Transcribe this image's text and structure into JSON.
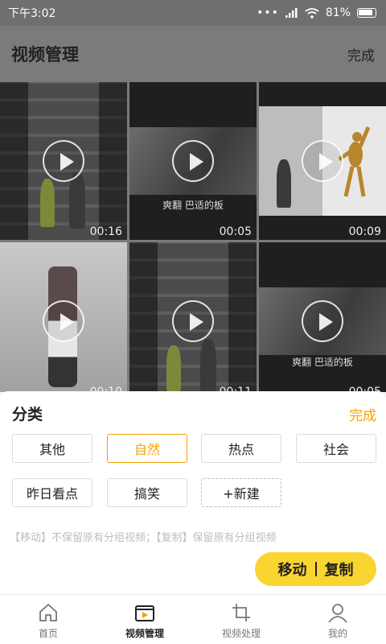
{
  "status_bar": {
    "time": "下午3:02",
    "battery": "81%"
  },
  "header": {
    "title": "视频管理",
    "done_label": "完成"
  },
  "videos": [
    {
      "duration": "00:16",
      "caption": ""
    },
    {
      "duration": "00:05",
      "caption": "爽翻 巴适的板"
    },
    {
      "duration": "00:09",
      "caption": ""
    },
    {
      "duration": "00:10",
      "caption": ""
    },
    {
      "duration": "00:11",
      "caption": ""
    },
    {
      "duration": "00:05",
      "caption": "爽翻 巴适的板"
    }
  ],
  "sheet": {
    "title": "分类",
    "done_label": "完成",
    "categories": [
      {
        "label": "其他",
        "selected": false
      },
      {
        "label": "自然",
        "selected": true
      },
      {
        "label": "热点",
        "selected": false
      },
      {
        "label": "社会",
        "selected": false
      },
      {
        "label": "昨日看点",
        "selected": false
      },
      {
        "label": "搞笑",
        "selected": false
      }
    ],
    "new_label": "+新建",
    "hint": "【移动】不保留原有分组视频；【复制】保留原有分组视频",
    "move_label": "移动",
    "copy_label": "复制"
  },
  "tabs": [
    {
      "label": "首页",
      "icon": "home-icon",
      "active": false
    },
    {
      "label": "视频管理",
      "icon": "video-manage-icon",
      "active": true
    },
    {
      "label": "视频处理",
      "icon": "crop-icon",
      "active": false
    },
    {
      "label": "我的",
      "icon": "user-icon",
      "active": false
    }
  ],
  "colors": {
    "accent": "#f5a300",
    "button": "#f9d531"
  }
}
